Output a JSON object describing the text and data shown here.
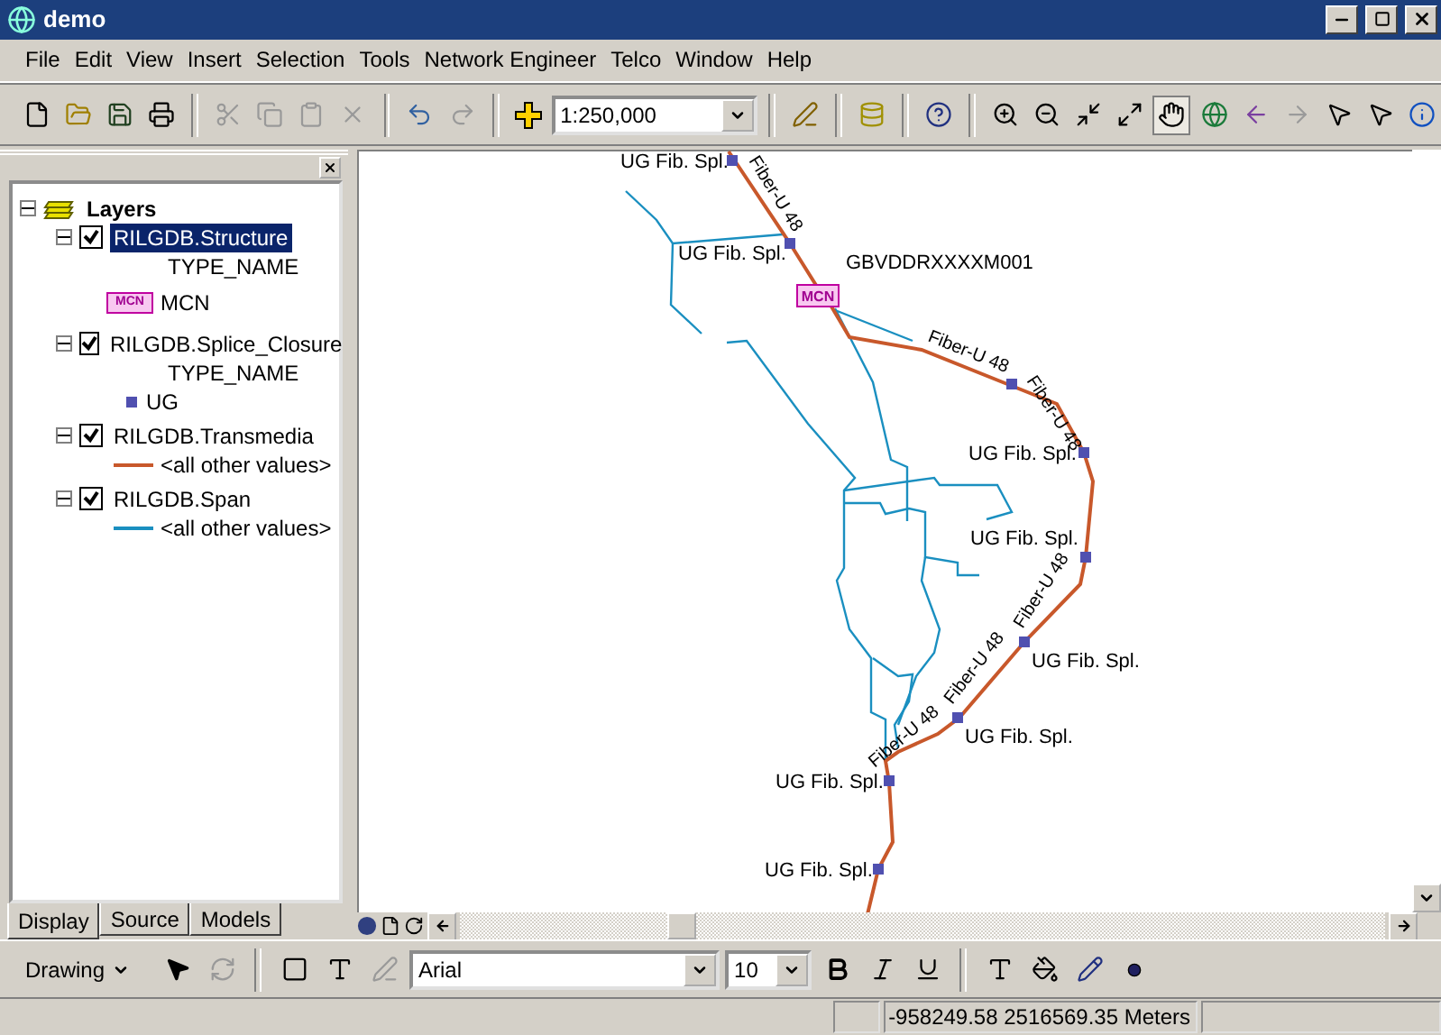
{
  "window": {
    "title": "demo"
  },
  "menu": [
    "File",
    "Edit",
    "View",
    "Insert",
    "Selection",
    "Tools",
    "Network Engineer",
    "Telco",
    "Window",
    "Help"
  ],
  "toolbar": {
    "scale": "1:250,000",
    "tools": [
      {
        "kind": "zoom-in",
        "selected": false
      },
      {
        "kind": "zoom-out",
        "selected": false
      },
      {
        "kind": "zoom-in-fixed",
        "selected": false
      },
      {
        "kind": "zoom-out-fixed",
        "selected": false
      },
      {
        "kind": "pan",
        "selected": true
      },
      {
        "kind": "full-extent",
        "selected": false
      },
      {
        "kind": "back",
        "selected": false
      },
      {
        "kind": "forward",
        "selected": false
      },
      {
        "kind": "select-features",
        "selected": false
      },
      {
        "kind": "select-elements",
        "selected": false
      },
      {
        "kind": "identify",
        "selected": false
      }
    ]
  },
  "toc": {
    "title": "Layers",
    "expanded": true,
    "layers": [
      {
        "name": "RILGDB.Structure",
        "checked": true,
        "expanded": true,
        "selected": true,
        "field": "TYPE_NAME",
        "legend": [
          {
            "kind": "box",
            "symbol_text": "MCN",
            "label": "MCN"
          }
        ]
      },
      {
        "name": "RILGDB.Splice_Closure",
        "checked": true,
        "expanded": true,
        "selected": false,
        "field": "TYPE_NAME",
        "legend": [
          {
            "kind": "point",
            "color": "#5050b0",
            "label": "UG"
          }
        ]
      },
      {
        "name": "RILGDB.Transmedia",
        "checked": true,
        "expanded": true,
        "selected": false,
        "legend": [
          {
            "kind": "line",
            "color": "#c8582b",
            "label": "<all other values>"
          }
        ]
      },
      {
        "name": "RILGDB.Span",
        "checked": true,
        "expanded": true,
        "selected": false,
        "legend": [
          {
            "kind": "line",
            "color": "#1a8fc0",
            "label": "<all other values>"
          }
        ]
      }
    ],
    "tabs": [
      {
        "label": "Display",
        "selected": true
      },
      {
        "label": "Source",
        "selected": false
      },
      {
        "label": "Models",
        "selected": false
      }
    ]
  },
  "map": {
    "structure_symbol": "MCN",
    "structure_label": "GBVDDRXXXXM001",
    "splice_labels": [
      "UG Fib. Spl.",
      "UG Fib. Spl.",
      "UG Fib. Spl.",
      "UG Fib. Spl.",
      "UG Fib. Spl.",
      "UG Fib. Spl.",
      "UG Fib. Spl.",
      "UG Fib. Spl."
    ],
    "fiber_labels": [
      "Fiber-U 48",
      "Fiber-U 48",
      "Fiber-U 48",
      "Fiber-U 48",
      "Fiber-U 48",
      "Fiber-U 48"
    ]
  },
  "drawing": {
    "menu": "Drawing",
    "font": "Arial",
    "size": "10"
  },
  "status": {
    "coordinates": "-958249.58  2516569.35 Meters"
  }
}
